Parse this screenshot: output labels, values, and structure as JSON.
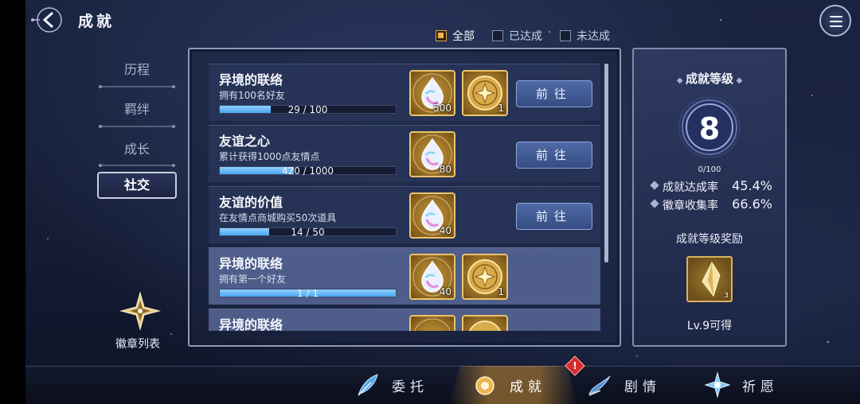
{
  "header": {
    "title": "成就"
  },
  "filters": [
    {
      "label": "全部",
      "checked": true
    },
    {
      "label": "已达成",
      "checked": false
    },
    {
      "label": "未达成",
      "checked": false
    }
  ],
  "sidebar": {
    "items": [
      {
        "label": "历程",
        "active": false
      },
      {
        "label": "羁绊",
        "active": false
      },
      {
        "label": "成长",
        "active": false
      },
      {
        "label": "社交",
        "active": true
      }
    ],
    "badge_list_label": "徽章列表"
  },
  "achievements": [
    {
      "title": "异境的联络",
      "desc": "拥有100名好友",
      "progress_text": "29 / 100",
      "progress": 0.29,
      "rewards": [
        {
          "icon": "prism-gem-icon",
          "qty": "500"
        },
        {
          "icon": "gold-coin-icon",
          "qty": "1"
        }
      ],
      "action": "前往"
    },
    {
      "title": "友谊之心",
      "desc": "累计获得1000点友情点",
      "progress_text": "420 / 1000",
      "progress": 0.42,
      "rewards": [
        {
          "icon": "prism-gem-icon",
          "qty": "80"
        }
      ],
      "action": "前往"
    },
    {
      "title": "友谊的价值",
      "desc": "在友情点商城购买50次道具",
      "progress_text": "14 / 50",
      "progress": 0.28,
      "rewards": [
        {
          "icon": "prism-gem-icon",
          "qty": "40"
        }
      ],
      "action": "前往"
    },
    {
      "title": "异境的联络",
      "desc": "拥有第一个好友",
      "progress_text": "1 / 1",
      "progress": 1.0,
      "rewards": [
        {
          "icon": "prism-gem-icon",
          "qty": "40"
        },
        {
          "icon": "gold-coin-icon",
          "qty": "1"
        }
      ],
      "action": ""
    },
    {
      "title": "异境的联络",
      "desc": "",
      "progress_text": "",
      "progress": 0,
      "rewards": [
        {
          "icon": "prism-gem-icon",
          "qty": ""
        },
        {
          "icon": "gold-coin-icon",
          "qty": ""
        }
      ],
      "action": ""
    }
  ],
  "rank": {
    "title": "成就等级",
    "level": "8",
    "level_progress": "0/100",
    "stats": [
      {
        "label": "成就达成率",
        "value": "45.4%"
      },
      {
        "label": "徽章收集率",
        "value": "66.6%"
      }
    ],
    "reward_title": "成就等级奖励",
    "reward_qty": "3",
    "reward_requirement": "Lv.9可得"
  },
  "bottom_nav": [
    {
      "label": "委托",
      "icon": "feather-icon",
      "active": false
    },
    {
      "label": "成就",
      "icon": "medal-icon",
      "active": true,
      "alert": "!"
    },
    {
      "label": "剧情",
      "icon": "quill-icon",
      "active": false
    },
    {
      "label": "祈愿",
      "icon": "star-burst-icon",
      "active": false
    }
  ],
  "colors": {
    "accent": "#f0b44e",
    "progress": "#4aa7f0",
    "button": "#364d83",
    "alert": "#d72c2c"
  }
}
